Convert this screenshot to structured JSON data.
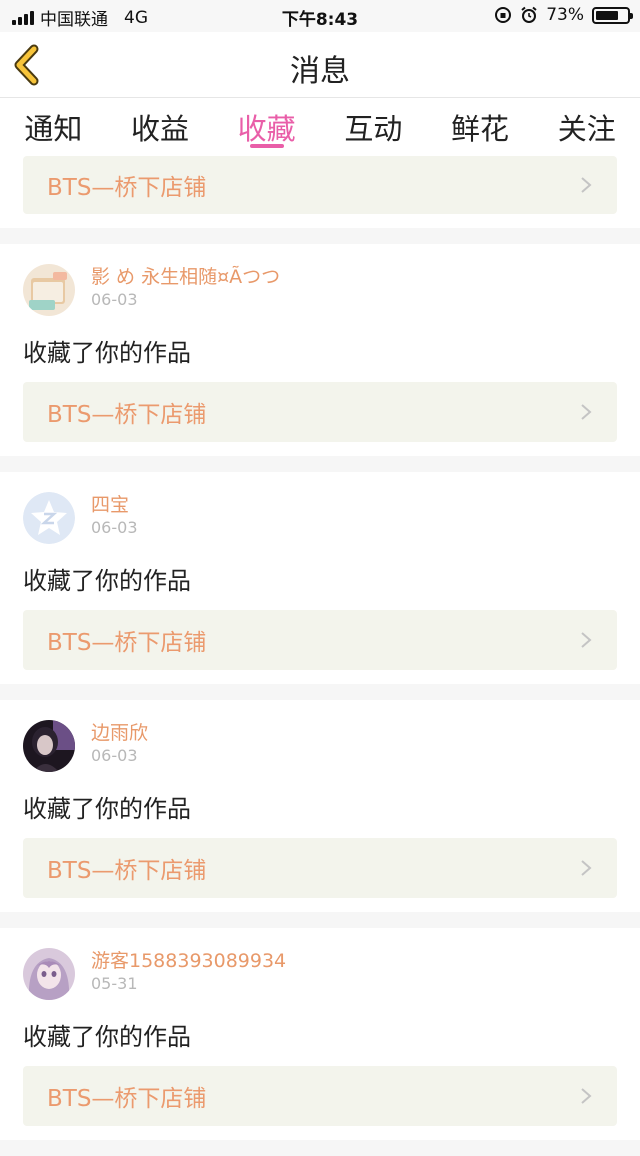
{
  "status_bar": {
    "carrier": "中国联通",
    "network": "4G",
    "time": "下午8:43",
    "battery": "73%",
    "battery_level": 0.73
  },
  "header": {
    "title": "消息",
    "back_icon": "chevron-left-icon"
  },
  "tabs": [
    {
      "label": "通知",
      "active": false
    },
    {
      "label": "收益",
      "active": false
    },
    {
      "label": "收藏",
      "active": true
    },
    {
      "label": "互动",
      "active": false
    },
    {
      "label": "鲜花",
      "active": false
    },
    {
      "label": "关注",
      "active": false
    }
  ],
  "colors": {
    "accent": "#e95ea8",
    "username": "#e8996a",
    "work_title": "#eb9a6e",
    "work_box_bg": "#f3f4ec"
  },
  "top_partial_card": {
    "work_title": "BTS—桥下店铺"
  },
  "messages": [
    {
      "username": "影 め 永生相随¤Ãつつ",
      "date": "06-03",
      "action": "收藏了你的作品",
      "work_title": "BTS—桥下店铺",
      "avatar": "book-avatar"
    },
    {
      "username": "四宝",
      "date": "06-03",
      "action": "收藏了你的作品",
      "work_title": "BTS—桥下店铺",
      "avatar": "qzone-star-avatar"
    },
    {
      "username": "边雨欣",
      "date": "06-03",
      "action": "收藏了你的作品",
      "work_title": "BTS—桥下店铺",
      "avatar": "dark-portrait-avatar"
    },
    {
      "username": "游客1588393089934",
      "date": "05-31",
      "action": "收藏了你的作品",
      "work_title": "BTS—桥下店铺",
      "avatar": "anime-girl-avatar"
    }
  ]
}
